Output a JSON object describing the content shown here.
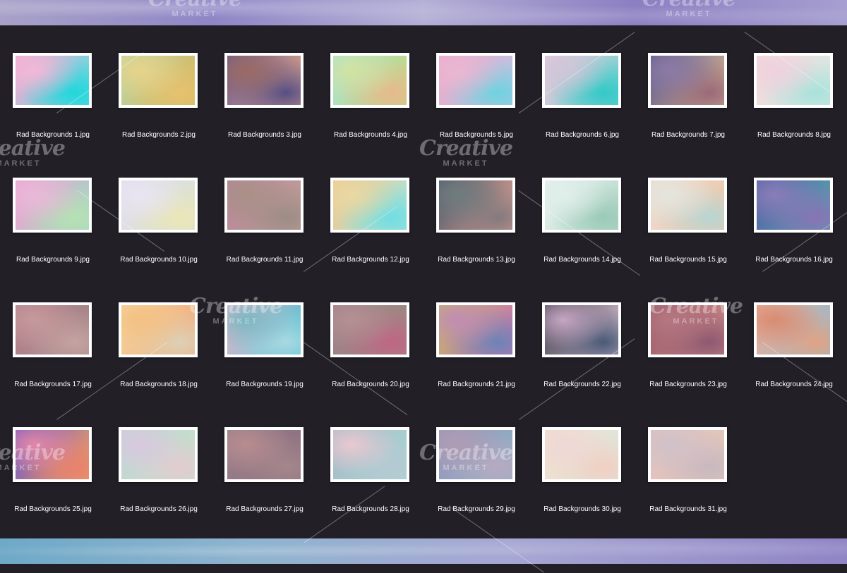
{
  "watermark": {
    "title": "Creative",
    "subtitle": "MARKET"
  },
  "files": [
    {
      "name": "Rad Backgrounds 1.jpg",
      "colors": [
        "#f6a8cf",
        "#f3b8d8",
        "#59e0e3",
        "#22d6db"
      ]
    },
    {
      "name": "Rad Backgrounds 2.jpg",
      "colors": [
        "#b9d6a7",
        "#e8d38a",
        "#d9b65a",
        "#e5c270"
      ]
    },
    {
      "name": "Rad Backgrounds 3.jpg",
      "colors": [
        "#6a5a8f",
        "#9a6a63",
        "#e6a887",
        "#574f86"
      ]
    },
    {
      "name": "Rad Backgrounds 4.jpg",
      "colors": [
        "#a9e3d6",
        "#d3e2a2",
        "#c4d778",
        "#e7b98e"
      ]
    },
    {
      "name": "Rad Backgrounds 5.jpg",
      "colors": [
        "#f0a8c9",
        "#eab7d2",
        "#b7c8e6",
        "#6fd2df"
      ]
    },
    {
      "name": "Rad Backgrounds 6.jpg",
      "colors": [
        "#ecc7dc",
        "#cfc6d8",
        "#6fd4cf",
        "#33c9c6"
      ]
    },
    {
      "name": "Rad Backgrounds 7.jpg",
      "colors": [
        "#5e5a8e",
        "#8b7aa6",
        "#d7b692",
        "#9b6a78"
      ]
    },
    {
      "name": "Rad Backgrounds 8.jpg",
      "colors": [
        "#f6d8db",
        "#eed1dd",
        "#d5eae4",
        "#a9e2da"
      ]
    },
    {
      "name": "Rad Backgrounds 9.jpg",
      "colors": [
        "#f3a0d2",
        "#e9b9d8",
        "#9fd8c6",
        "#b6e1b3"
      ]
    },
    {
      "name": "Rad Backgrounds 10.jpg",
      "colors": [
        "#e1ddef",
        "#e8e5f1",
        "#d9e3cc",
        "#eae6b8"
      ]
    },
    {
      "name": "Rad Backgrounds 11.jpg",
      "colors": [
        "#b7859a",
        "#a99087",
        "#c0a196",
        "#9d8c87"
      ]
    },
    {
      "name": "Rad Backgrounds 12.jpg",
      "colors": [
        "#f3c88c",
        "#e9d8a3",
        "#a6e6df",
        "#72dde2"
      ]
    },
    {
      "name": "Rad Backgrounds 13.jpg",
      "colors": [
        "#4f5b6d",
        "#6f7c7e",
        "#e0a193",
        "#857a7e"
      ]
    },
    {
      "name": "Rad Backgrounds 14.jpg",
      "colors": [
        "#e6f1ee",
        "#dfeee9",
        "#b9d9cc",
        "#9bcab9"
      ]
    },
    {
      "name": "Rad Backgrounds 15.jpg",
      "colors": [
        "#eaded6",
        "#e4e5dd",
        "#f1c4a2",
        "#b8d6d3"
      ]
    },
    {
      "name": "Rad Backgrounds 16.jpg",
      "colors": [
        "#5560a5",
        "#8a7db8",
        "#58a5b0",
        "#8873b4"
      ]
    },
    {
      "name": "Rad Backgrounds 17.jpg",
      "colors": [
        "#b57f8c",
        "#c69a9c",
        "#a18788",
        "#c6a3a1"
      ]
    },
    {
      "name": "Rad Backgrounds 18.jpg",
      "colors": [
        "#f4d7a0",
        "#f3c183",
        "#f1a678",
        "#ddd0b5"
      ]
    },
    {
      "name": "Rad Backgrounds 19.jpg",
      "colors": [
        "#ecb6c8",
        "#7cb7c3",
        "#43c2d5",
        "#a8d9e1"
      ]
    },
    {
      "name": "Rad Backgrounds 20.jpg",
      "colors": [
        "#a08089",
        "#b49094",
        "#9c8a7f",
        "#c06685"
      ]
    },
    {
      "name": "Rad Backgrounds 21.jpg",
      "colors": [
        "#c3b76a",
        "#c28cb4",
        "#cc6fb7",
        "#6d83b6"
      ]
    },
    {
      "name": "Rad Backgrounds 22.jpg",
      "colors": [
        "#3d3d4c",
        "#c6a6c3",
        "#e5c8d9",
        "#4a5a77"
      ]
    },
    {
      "name": "Rad Backgrounds 23.jpg",
      "colors": [
        "#9a5967",
        "#b47781",
        "#d28e8d",
        "#8e5970"
      ]
    },
    {
      "name": "Rad Backgrounds 24.jpg",
      "colors": [
        "#efae97",
        "#d98c72",
        "#8fbad0",
        "#e1a385"
      ]
    },
    {
      "name": "Rad Backgrounds 25.jpg",
      "colors": [
        "#6a58c5",
        "#e387a8",
        "#f2a063",
        "#e8826d"
      ]
    },
    {
      "name": "Rad Backgrounds 26.jpg",
      "colors": [
        "#c4d4d6",
        "#d9c8df",
        "#c2e2c8",
        "#e3cbd0"
      ]
    },
    {
      "name": "Rad Backgrounds 27.jpg",
      "colors": [
        "#9b7e8b",
        "#b78d8f",
        "#8b6f7f",
        "#a5868c"
      ]
    },
    {
      "name": "Rad Backgrounds 28.jpg",
      "colors": [
        "#a6b9c7",
        "#e9c8d0",
        "#a8d6d3",
        "#b5c9d3"
      ]
    },
    {
      "name": "Rad Backgrounds 29.jpg",
      "colors": [
        "#9b96b9",
        "#b09cb4",
        "#8cb1c6",
        "#b7aac2"
      ]
    },
    {
      "name": "Rad Backgrounds 30.jpg",
      "colors": [
        "#f6ddcd",
        "#eed8d6",
        "#d8e8de",
        "#f1cfc2"
      ]
    },
    {
      "name": "Rad Backgrounds 31.jpg",
      "colors": [
        "#e3c1c0",
        "#cfc1c9",
        "#e1c7b8",
        "#c9b8c0"
      ]
    }
  ]
}
